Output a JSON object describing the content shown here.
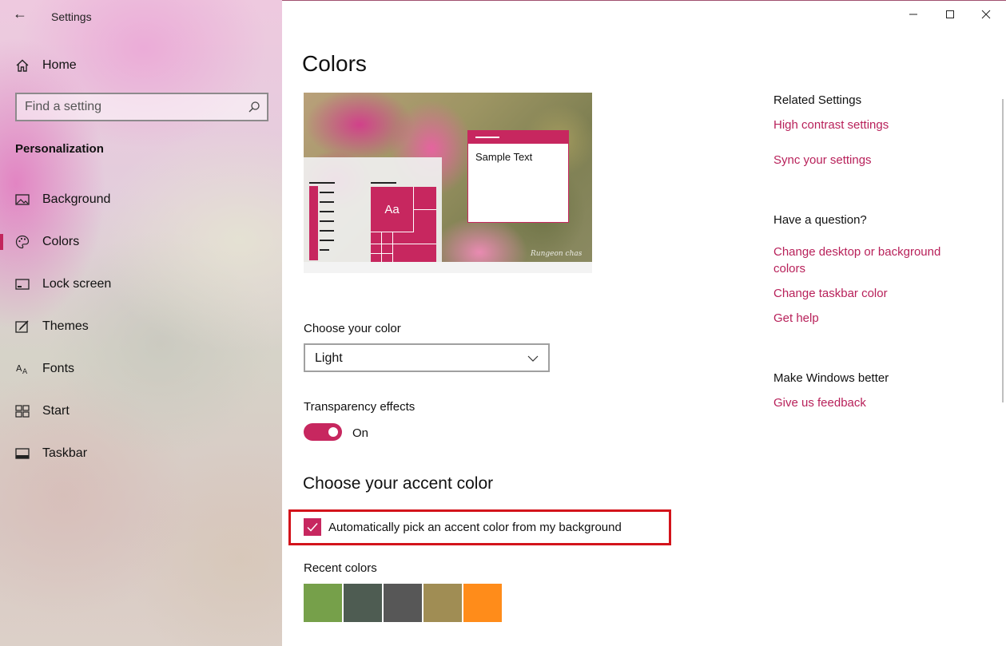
{
  "window": {
    "title": "Settings",
    "back_icon": "←",
    "minimize_icon": "minimize-icon",
    "maximize_icon": "maximize-icon",
    "close_icon": "close-icon"
  },
  "sidebar": {
    "home_label": "Home",
    "search_placeholder": "Find a setting",
    "section_label": "Personalization",
    "items": [
      {
        "label": "Background",
        "icon": "image-icon"
      },
      {
        "label": "Colors",
        "icon": "palette-icon",
        "active": true
      },
      {
        "label": "Lock screen",
        "icon": "lock-screen-icon"
      },
      {
        "label": "Themes",
        "icon": "themes-icon"
      },
      {
        "label": "Fonts",
        "icon": "fonts-icon"
      },
      {
        "label": "Start",
        "icon": "start-icon"
      },
      {
        "label": "Taskbar",
        "icon": "taskbar-icon"
      }
    ]
  },
  "main": {
    "title": "Colors",
    "preview": {
      "sample_text": "Sample Text",
      "tile_text": "Aa",
      "watermark": "Rungeon chas"
    },
    "choose_color_label": "Choose your color",
    "choose_color_value": "Light",
    "transparency_label": "Transparency effects",
    "transparency_state": "On",
    "accent_heading": "Choose your accent color",
    "auto_accent_label": "Automatically pick an accent color from my background",
    "recent_colors_label": "Recent colors",
    "recent_colors": [
      "#76a04a",
      "#4e5c52",
      "#575757",
      "#a08d54",
      "#ff8c1a"
    ]
  },
  "related": {
    "related_heading": "Related Settings",
    "high_contrast_link": "High contrast settings",
    "sync_link": "Sync your settings",
    "question_heading": "Have a question?",
    "change_desktop_link": "Change desktop or background colors",
    "change_taskbar_link": "Change taskbar color",
    "help_link": "Get help",
    "better_heading": "Make Windows better",
    "feedback_link": "Give us feedback"
  },
  "accent_color": "#c7275f",
  "link_color": "#b8215a",
  "highlight_color": "#d3131b"
}
